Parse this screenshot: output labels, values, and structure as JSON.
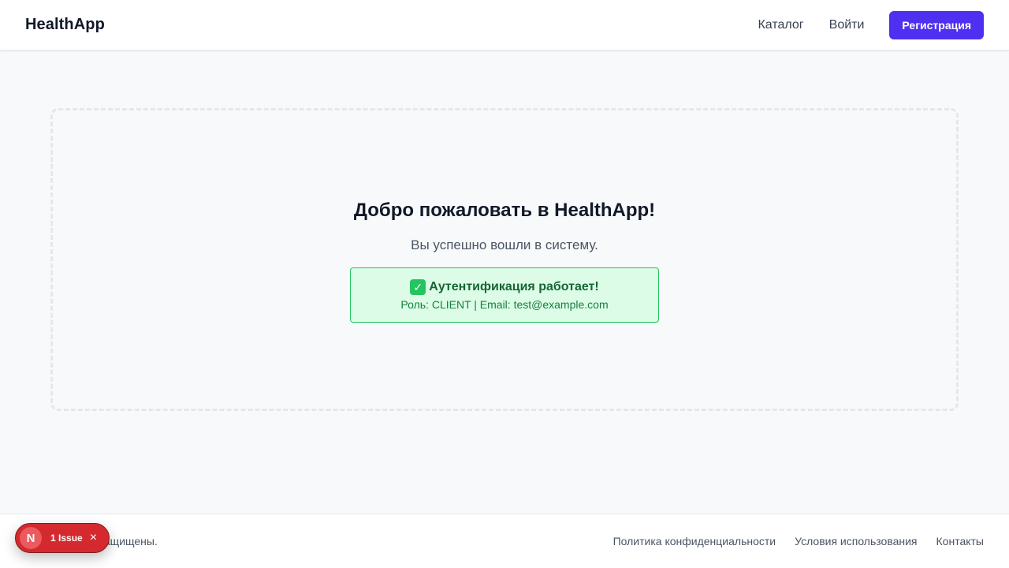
{
  "header": {
    "brand": "HealthApp",
    "nav": {
      "catalog": "Каталог",
      "login": "Войти",
      "register": "Регистрация"
    }
  },
  "main": {
    "title": "Добро пожаловать в HealthApp!",
    "subtitle": "Вы успешно вошли в систему.",
    "auth_status": {
      "icon": "check-mark-icon",
      "title": "Аутентификация работает!",
      "info": "Роль: CLIENT | Email: test@example.com"
    }
  },
  "footer": {
    "copyright": "pp. Все права защищены.",
    "links": {
      "privacy": "Политика конфиденциальности",
      "terms": "Условия использования",
      "contacts": "Контакты"
    }
  },
  "dev_overlay": {
    "logo": "N",
    "issues": "1 Issue",
    "close": "×"
  },
  "colors": {
    "accent": "#4f2ff0",
    "success_bg": "#dcfce7",
    "success_border": "#22c55e",
    "success_text": "#166534",
    "issue_badge": "#d42a2f"
  }
}
